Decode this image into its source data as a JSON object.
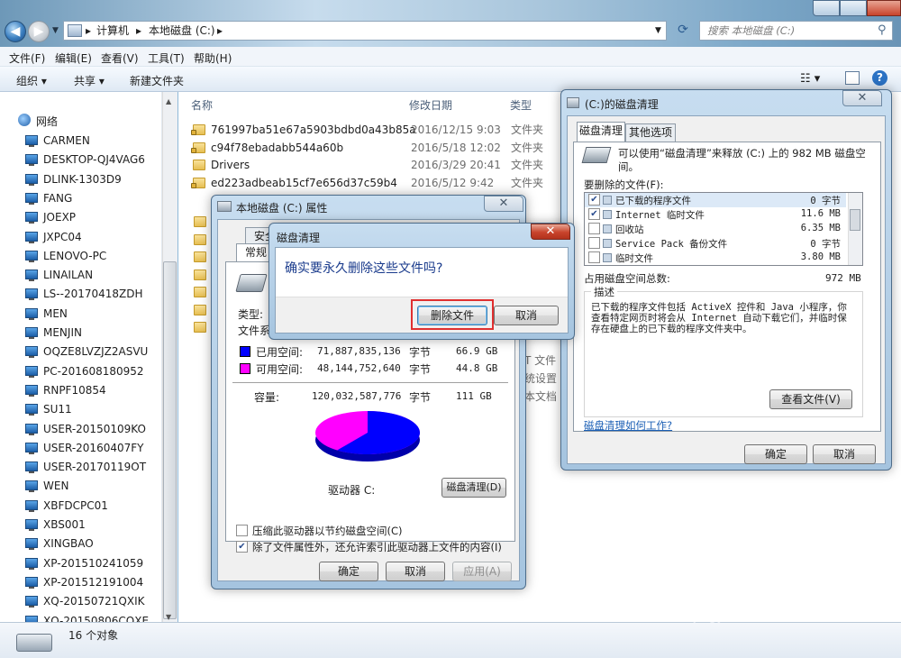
{
  "explorer": {
    "breadcrumb": [
      "计算机",
      "本地磁盘 (C:)"
    ],
    "search_placeholder": "搜索 本地磁盘 (C:)",
    "menu": [
      "文件(F)",
      "编辑(E)",
      "查看(V)",
      "工具(T)",
      "帮助(H)"
    ],
    "toolbar": {
      "organize": "组织 ▾",
      "share": "共享 ▾",
      "new_folder": "新建文件夹"
    },
    "sidebar": {
      "network": "网络",
      "items": [
        "CARMEN",
        "DESKTOP-QJ4VAG6",
        "DLINK-1303D9",
        "FANG",
        "JOEXP",
        "JXPC04",
        "LENOVO-PC",
        "LINAILAN",
        "LS--20170418ZDH",
        "MEN",
        "MENJIN",
        "OQZE8LVZJZ2ASVU",
        "PC-201608180952",
        "RNPF10854",
        "SU11",
        "USER-20150109KO",
        "USER-20160407FY",
        "USER-20170119OT",
        "WEN",
        "XBFDCPC01",
        "XBS001",
        "XINGBAO",
        "XP-201510241059",
        "XP-201512191004",
        "XQ-20150721QXIK",
        "XQ-20150806CQXE"
      ]
    },
    "columns": {
      "name": "名称",
      "date": "修改日期",
      "type": "类型"
    },
    "files": [
      {
        "name": "761997ba51e67a5903bdbd0a43b85a",
        "date": "2016/12/15 9:03",
        "type": "文件夹"
      },
      {
        "name": "c94f78ebadabb544a60b",
        "date": "2016/5/18 12:02",
        "type": "文件夹"
      },
      {
        "name": "Drivers",
        "date": "2016/3/29 20:41",
        "type": "文件夹"
      },
      {
        "name": "ed223adbeab15cf7e656d37c59b4",
        "date": "2016/5/12 9:42",
        "type": "文件夹"
      }
    ],
    "partial_types": [
      "T 文件",
      "统设置",
      "本文档"
    ],
    "status": "16 个对象"
  },
  "properties": {
    "title": "本地磁盘 (C:) 属性",
    "tabs": {
      "security": "安全",
      "general": "常规"
    },
    "type_label": "类型:",
    "fs_label": "文件系统",
    "used": {
      "label": "已用空间:",
      "bytes": "71,887,835,136",
      "unit": "字节",
      "size": "66.9 GB",
      "color": "#0000ff"
    },
    "free": {
      "label": "可用空间:",
      "bytes": "48,144,752,640",
      "unit": "字节",
      "size": "44.8 GB",
      "color": "#ff00ff"
    },
    "capacity": {
      "label": "容量:",
      "bytes": "120,032,587,776",
      "unit": "字节",
      "size": "111 GB"
    },
    "used_fraction": 0.599,
    "drive_label": "驱动器 C:",
    "cleanup_button": "磁盘清理(D)",
    "compress_label": "压缩此驱动器以节约磁盘空间(C)",
    "compress_checked": false,
    "index_label": "除了文件属性外，还允许索引此驱动器上文件的内容(I)",
    "index_checked": true,
    "ok": "确定",
    "cancel": "取消",
    "apply": "应用(A)"
  },
  "confirm": {
    "title": "磁盘清理",
    "message": "确实要永久删除这些文件吗?",
    "delete_button": "删除文件",
    "cancel_button": "取消",
    "highlight_color": "#e03030"
  },
  "cleanup": {
    "title": "(C:)的磁盘清理",
    "tabs": [
      "磁盘清理",
      "其他选项"
    ],
    "intro": "可以使用“磁盘清理”来释放  (C:) 上的 982 MB 磁盘空间。",
    "files_label": "要删除的文件(F):",
    "items": [
      {
        "name": "已下载的程序文件",
        "size": "0 字节",
        "checked": true
      },
      {
        "name": "Internet 临时文件",
        "size": "11.6 MB",
        "checked": true
      },
      {
        "name": "回收站",
        "size": "6.35 MB",
        "checked": false
      },
      {
        "name": "Service Pack 备份文件",
        "size": "0 字节",
        "checked": false
      },
      {
        "name": "临时文件",
        "size": "3.80 MB",
        "checked": false
      }
    ],
    "total_label": "占用磁盘空间总数:",
    "total_value": "972 MB",
    "desc_label": "描述",
    "description": "已下载的程序文件包括 ActiveX 控件和 Java 小程序，你查看特定网页时将会从 Internet 自动下载它们，并临时保存在硬盘上的已下载的程序文件夹中。",
    "view_files": "查看文件(V)",
    "how_link": "磁盘清理如何工作?",
    "ok": "确定",
    "cancel": "取消"
  }
}
